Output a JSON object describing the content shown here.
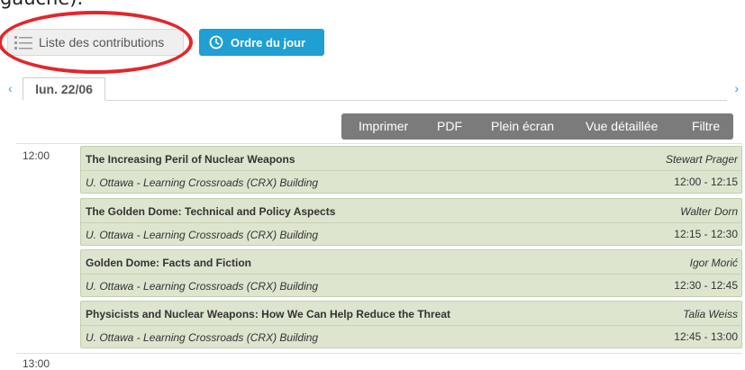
{
  "caption_fragment": "gauche).",
  "view_toggle": {
    "list_label": "Liste des contributions",
    "agenda_label": "Ordre du jour"
  },
  "day_tabs": {
    "active_day": "lun. 22/06",
    "prev_arrow": "‹",
    "next_arrow": "›"
  },
  "toolbar": {
    "print": "Imprimer",
    "pdf": "PDF",
    "fullscreen": "Plein écran",
    "detailed": "Vue détaillée",
    "filter": "Filtre"
  },
  "time_labels": [
    "12:00",
    "13:00"
  ],
  "entries": [
    {
      "title": "The Increasing Peril of Nuclear Weapons",
      "speaker": "Stewart Prager",
      "location": "U. Ottawa - Learning Crossroads (CRX) Building",
      "time": "12:00 - 12:15"
    },
    {
      "title": "The Golden Dome: Technical and Policy Aspects",
      "speaker": "Walter Dorn",
      "location": "U. Ottawa - Learning Crossroads (CRX) Building",
      "time": "12:15 - 12:30"
    },
    {
      "title": "Golden Dome: Facts and Fiction",
      "speaker": "Igor Morić",
      "location": "U. Ottawa - Learning Crossroads (CRX) Building",
      "time": "12:30 - 12:45"
    },
    {
      "title": "Physicists and Nuclear Weapons: How We Can Help Reduce the Threat",
      "speaker": "Talia Weiss",
      "location": "U. Ottawa - Learning Crossroads (CRX) Building",
      "time": "12:45 - 13:00"
    }
  ],
  "colors": {
    "agenda_button": "#1f9fd3",
    "highlight_ring": "#e3262b",
    "toolbar": "#7b7b7b",
    "entry_background": "#dde5cf"
  }
}
